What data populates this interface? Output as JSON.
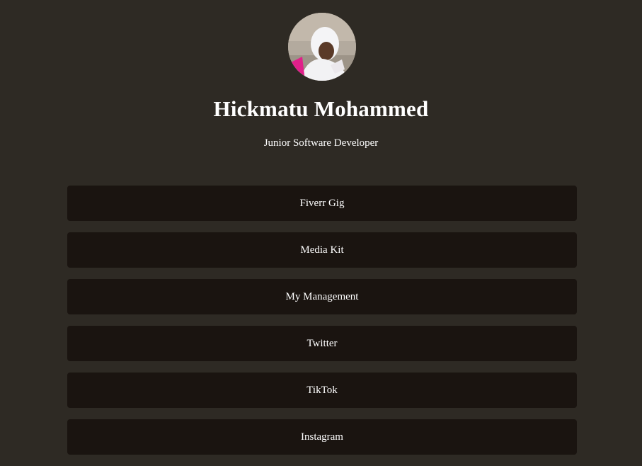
{
  "profile": {
    "name": "Hickmatu Mohammed",
    "tagline": "Junior Software Developer"
  },
  "links": [
    {
      "label": "Fiverr Gig"
    },
    {
      "label": "Media Kit"
    },
    {
      "label": "My Management"
    },
    {
      "label": "Twitter"
    },
    {
      "label": "TikTok"
    },
    {
      "label": "Instagram"
    }
  ],
  "colors": {
    "background": "#2e2a24",
    "button": "#1a1410",
    "text": "#ffffff"
  }
}
